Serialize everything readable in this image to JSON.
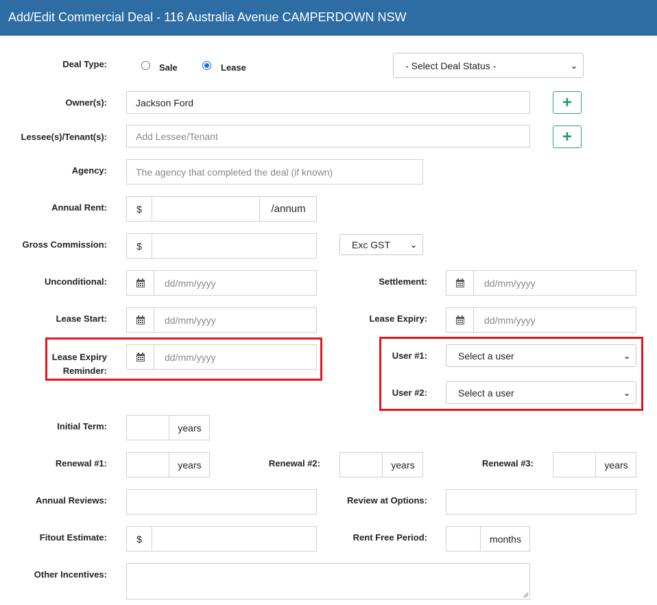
{
  "header": {
    "title": "Add/Edit Commercial Deal - 116 Australia Avenue CAMPERDOWN NSW"
  },
  "deal_type": {
    "label": "Deal Type:",
    "options": [
      {
        "label": "Sale",
        "selected": false
      },
      {
        "label": "Lease",
        "selected": true
      }
    ],
    "status_select": "- Select Deal Status -"
  },
  "owners": {
    "label": "Owner(s):",
    "value": "Jackson Ford",
    "add": "+"
  },
  "lessee": {
    "label": "Lessee(s)/Tenant(s):",
    "placeholder": "Add Lessee/Tenant",
    "add": "+"
  },
  "agency": {
    "label": "Agency:",
    "placeholder": "The agency that completed the deal (if known)"
  },
  "annual_rent": {
    "label": "Annual Rent:",
    "prefix": "$",
    "suffix": "/annum"
  },
  "gross_commission": {
    "label": "Gross Commission:",
    "prefix": "$",
    "gst_select": "Exc GST"
  },
  "dates": {
    "placeholder": "dd/mm/yyyy",
    "unconditional": "Unconditional:",
    "settlement": "Settlement:",
    "lease_start": "Lease Start:",
    "lease_expiry": "Lease Expiry:",
    "reminder_line1": "Lease Expiry",
    "reminder_line2": "Reminder:"
  },
  "users": {
    "user1": "User #1:",
    "user2": "User #2:",
    "select": "Select a user"
  },
  "terms": {
    "initial": "Initial Term:",
    "renewal1": "Renewal #1:",
    "renewal2": "Renewal #2:",
    "renewal3": "Renewal #3:",
    "unit": "years"
  },
  "reviews": {
    "annual": "Annual Reviews:",
    "options": "Review at Options:"
  },
  "fitout": {
    "label": "Fitout Estimate:",
    "prefix": "$"
  },
  "rent_free": {
    "label": "Rent Free Period:",
    "unit": "months"
  },
  "other": {
    "label": "Other Incentives:"
  },
  "colors": {
    "header": "#2e6da4",
    "highlight": "#e8141c",
    "plus": "#1a9b72"
  }
}
